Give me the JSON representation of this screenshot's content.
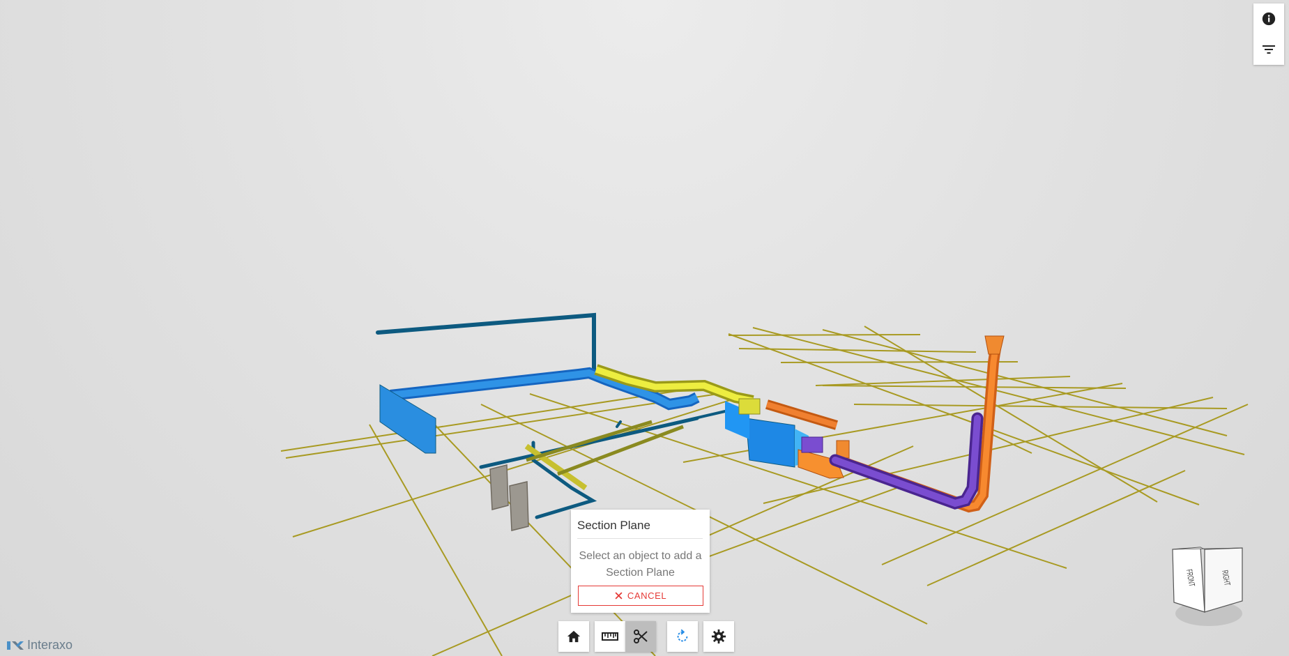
{
  "popup": {
    "title": "Section Plane",
    "message": "Select an object to add a Section Plane",
    "cancel_label": "CANCEL"
  },
  "side_toolbar": {
    "items": [
      {
        "icon": "info-icon"
      },
      {
        "icon": "filter-icon"
      }
    ]
  },
  "bottom_toolbar": {
    "items": [
      {
        "icon": "home-icon"
      },
      {
        "icon": "ruler-icon"
      },
      {
        "icon": "scissors-icon",
        "active": true
      },
      {
        "icon": "rotate-icon"
      },
      {
        "icon": "gear-icon"
      }
    ]
  },
  "view_cube": {
    "front_label": "FRONT",
    "right_label": "RIGHT"
  },
  "logo": {
    "text": "Interaxo"
  },
  "colors": {
    "grid": "#b0a020",
    "duct_dark": "#0d5a80",
    "duct_light": "#2196f3",
    "duct_yellow": "#e8e838",
    "pipe_orange": "#f57c20",
    "pipe_purple": "#6a3db8",
    "cancel_red": "#e53935"
  }
}
